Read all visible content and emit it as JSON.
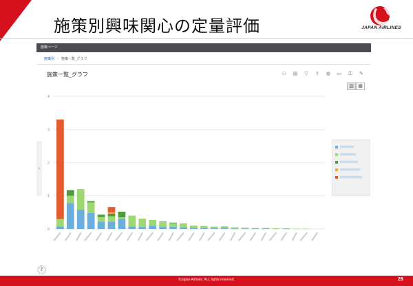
{
  "slide": {
    "title": "施策別興味関心の定量評価",
    "logo_text": "JAPAN AIRLINES",
    "footer": "©Japan Airlines. ALL rights reserved.",
    "page_number": "28"
  },
  "app": {
    "bar_title": "施策ページ",
    "breadcrumb": {
      "home": "施策別",
      "separator": "›",
      "current": "施策一覧_グラフ"
    },
    "panel_title": "施策一覧_グラフ",
    "toolbar_icons": [
      "user-plus-icon",
      "comment-icon",
      "filter-icon",
      "export-icon",
      "globe-icon",
      "print-icon",
      "lock-icon",
      "wrench-icon"
    ],
    "view_toggle": [
      "bar-chart-icon",
      "table-icon"
    ],
    "help": "?"
  },
  "colors": {
    "brand_red": "#d4111c",
    "series": [
      "#6aaee0",
      "#9ed873",
      "#4f9b3a",
      "#f2a53b",
      "#e55a2f"
    ]
  },
  "chart_data": {
    "type": "bar",
    "stacked": true,
    "ylim": [
      0,
      4
    ],
    "yticks": [
      "0",
      "1",
      "2",
      "3",
      "4"
    ],
    "grid": true,
    "legend_position": "right",
    "categories": [
      "",
      "",
      "",
      "",
      "",
      "",
      "",
      "",
      "",
      "",
      "",
      "",
      "",
      "",
      "",
      "",
      "",
      "",
      "",
      "",
      "",
      "",
      "",
      "",
      "",
      ""
    ],
    "series": [
      {
        "values": [
          0.08,
          0.78,
          0.58,
          0.48,
          0.22,
          0.22,
          0.3,
          0.08,
          0.06,
          0.1,
          0.06,
          0.07,
          0.05,
          0.03,
          0.03,
          0.02,
          0.02,
          0.01,
          0.01,
          0.01,
          0.01,
          0.0,
          0.01,
          0.0,
          0.0,
          0.0
        ]
      },
      {
        "values": [
          0.22,
          0.22,
          0.62,
          0.32,
          0.14,
          0.16,
          0.05,
          0.32,
          0.25,
          0.17,
          0.15,
          0.1,
          0.12,
          0.07,
          0.06,
          0.05,
          0.04,
          0.04,
          0.03,
          0.02,
          0.02,
          0.02,
          0.01,
          0.01,
          0.01,
          0.0
        ]
      },
      {
        "values": [
          0.0,
          0.17,
          0.0,
          0.04,
          0.07,
          0.08,
          0.17,
          0.0,
          0.0,
          0.0,
          0.01,
          0.02,
          0.0,
          0.0,
          0.0,
          0.0,
          0.01,
          0.0,
          0.0,
          0.0,
          0.0,
          0.0,
          0.0,
          0.0,
          0.0,
          0.0
        ]
      },
      {
        "values": [
          0.0,
          0.0,
          0.0,
          0.0,
          0.0,
          0.04,
          0.0,
          0.0,
          0.0,
          0.0,
          0.0,
          0.0,
          0.0,
          0.0,
          0.0,
          0.0,
          0.0,
          0.0,
          0.0,
          0.0,
          0.0,
          0.0,
          0.0,
          0.0,
          0.0,
          0.0
        ]
      },
      {
        "values": [
          3.0,
          0.0,
          0.0,
          0.0,
          0.0,
          0.16,
          0.0,
          0.0,
          0.0,
          0.0,
          0.0,
          0.0,
          0.0,
          0.0,
          0.0,
          0.0,
          0.0,
          0.0,
          0.0,
          0.0,
          0.0,
          0.0,
          0.0,
          0.0,
          0.0,
          0.0
        ]
      }
    ]
  }
}
